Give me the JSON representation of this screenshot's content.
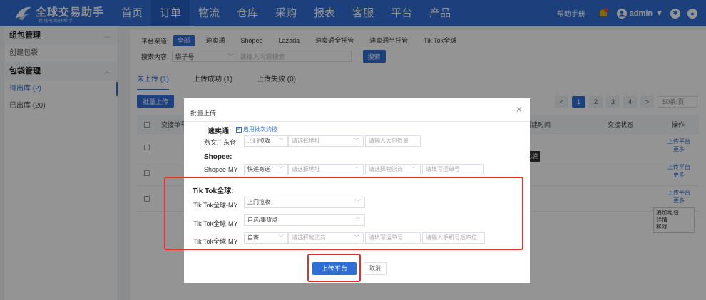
{
  "header": {
    "logo_title": "全球交易助手",
    "logo_subtitle": "跨境电商好帮手",
    "nav": [
      "首页",
      "订单",
      "物流",
      "仓库",
      "采购",
      "报表",
      "客服",
      "平台",
      "产品"
    ],
    "active_nav": "订单",
    "help_label": "帮助手册",
    "user_name": "admin"
  },
  "sidebar": {
    "groups": [
      {
        "title": "组包管理",
        "items": [
          "创建包袋"
        ]
      },
      {
        "title": "包袋管理",
        "items": [
          "待出库 (2)",
          "已出库 (20)"
        ]
      }
    ]
  },
  "filters": {
    "channel_label": "平台渠道:",
    "channels": [
      "全部",
      "速卖通",
      "Shopee",
      "Lazada",
      "速卖通全托管",
      "速卖通半托管",
      "Tik Tok全球"
    ],
    "active_channel": "全部",
    "search_label": "搜索内容:",
    "search_field": "袋子号",
    "search_placeholder": "请输入内容搜索",
    "search_button": "搜索"
  },
  "tabs": [
    "未上传 (1)",
    "上传成功 (1)",
    "上传失败 (0)"
  ],
  "toolbar": {
    "batch_upload": "批量上传"
  },
  "pager": {
    "pages": [
      "1",
      "2",
      "3",
      "4"
    ],
    "prev": "<",
    "next": ">",
    "page_size": "50条/页"
  },
  "table": {
    "headers": {
      "handover_no": "交接单号",
      "created": "创建时间",
      "status": "交接状态",
      "ops": "操作"
    },
    "row_ops": [
      [
        "上传平台",
        "更多"
      ],
      [
        "上传平台",
        "更多"
      ],
      [
        "上传平台",
        "更多"
      ]
    ],
    "tooltip": "包袋",
    "more_menu": [
      "追加组包",
      "详情",
      "移除"
    ]
  },
  "modal": {
    "title": "批量上传",
    "aliexpress": {
      "title": "速卖通:",
      "batch_check": "启用批次约揽",
      "row_label": "燕文广东仓",
      "pickup": "上门揽收",
      "address_ph": "请选择地址",
      "bags_ph": "请输入大包数量"
    },
    "shopee": {
      "title": "Shopee:",
      "row_label": "Shopee-MY",
      "delivery": "快递寄送",
      "address_ph": "请选择地址",
      "carrier_ph": "请选择物流商",
      "tracking_ph": "请填写运单号"
    },
    "tiktok": {
      "title": "Tik Tok全球:",
      "rows": [
        {
          "label": "Tik Tok全球-MY",
          "value": "上门揽收"
        },
        {
          "label": "Tik Tok全球-MY",
          "value": "自送/集货点"
        },
        {
          "label": "Tik Tok全球-MY",
          "value": "自寄"
        }
      ],
      "carrier_ph": "请选择物流商",
      "tracking_ph": "请填写运单号",
      "phone_ph": "请输入手机号后四位"
    },
    "confirm": "上传平台",
    "cancel": "取消"
  }
}
